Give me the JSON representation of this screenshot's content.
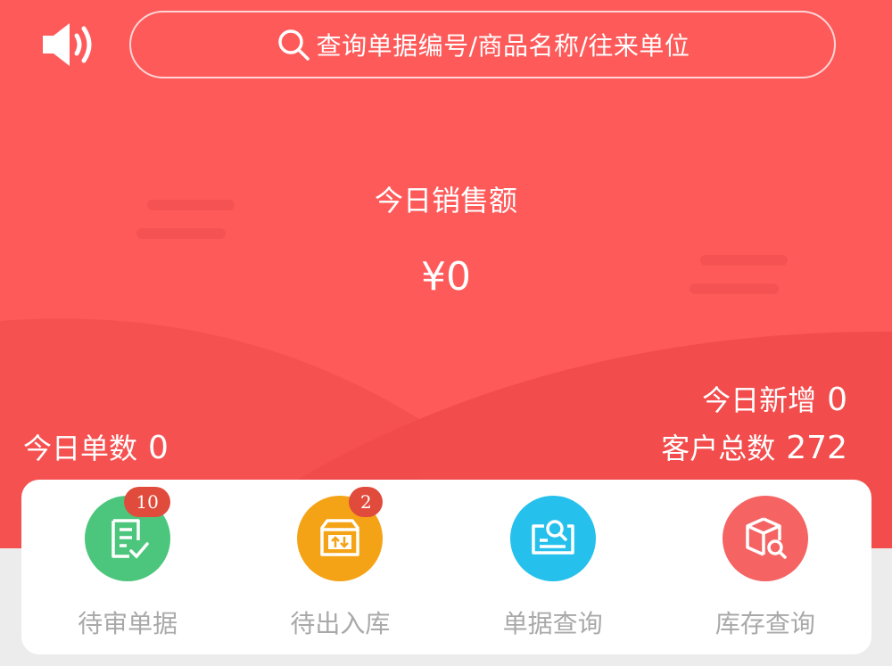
{
  "header": {
    "search_placeholder": "查询单据编号/商品名称/往来单位",
    "speaker_icon": "speaker-icon"
  },
  "sales": {
    "title": "今日销售额",
    "value": "¥0"
  },
  "stats": {
    "orders_label": "今日单数",
    "orders_value": "0",
    "new_label": "今日新增",
    "new_value": "0",
    "total_label": "客户总数",
    "total_value": "272"
  },
  "menu": {
    "items": [
      {
        "label": "待审单据",
        "badge": "10",
        "color": "#4cc67c",
        "icon": "document-check-icon"
      },
      {
        "label": "待出入库",
        "badge": "2",
        "color": "#f5a316",
        "icon": "box-in-out-icon"
      },
      {
        "label": "单据查询",
        "badge": "",
        "color": "#26c0ec",
        "icon": "document-search-icon"
      },
      {
        "label": "库存查询",
        "badge": "",
        "color": "#f56363",
        "icon": "inventory-search-icon"
      }
    ]
  },
  "colors": {
    "hero_bg": "#fe5a5a",
    "badge_bg": "#e04b3c",
    "label_gray": "#a9a9a9"
  }
}
